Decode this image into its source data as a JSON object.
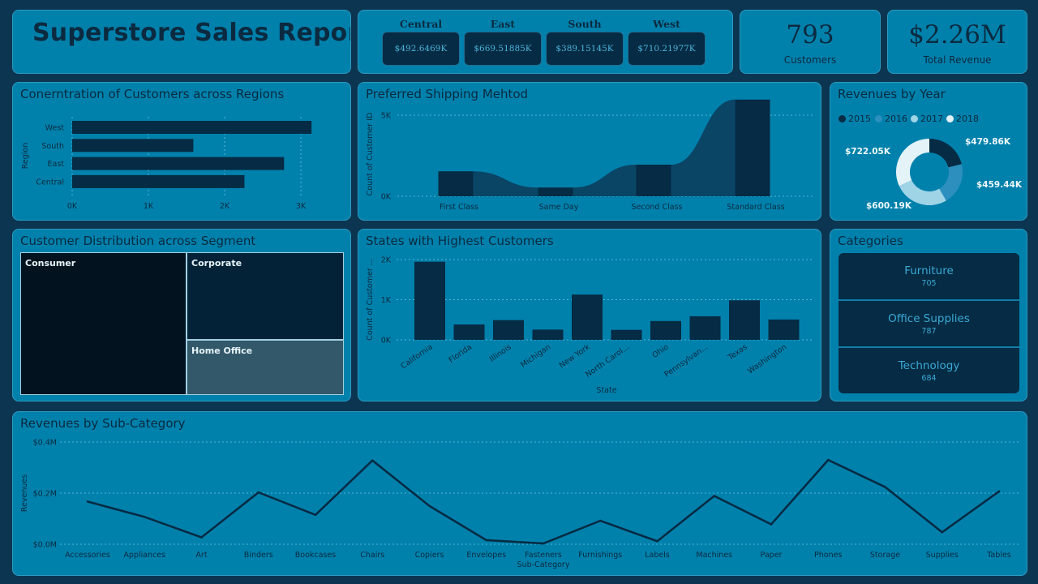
{
  "report_title": "Superstore Sales Report",
  "regions_kpi": [
    {
      "name": "Central",
      "value": "$492.6469K"
    },
    {
      "name": "East",
      "value": "$669.51885K"
    },
    {
      "name": "South",
      "value": "$389.15145K"
    },
    {
      "name": "West",
      "value": "$710.21977K"
    }
  ],
  "customers_kpi": {
    "value": "793",
    "label": "Customers"
  },
  "revenue_kpi": {
    "value": "$2.26M",
    "label": "Total Revenue"
  },
  "titles": {
    "regions": "Conerntration of Customers across Regions",
    "shipping": "Preferred Shipping Mehtod",
    "year": "Revenues by Year",
    "segment": "Customer Distribution across Segment",
    "states": "States with Highest Customers",
    "categories": "Categories",
    "subcat": "Revenues by Sub-Category"
  },
  "segments": [
    {
      "name": "Consumer",
      "color": "#02131f"
    },
    {
      "name": "Corporate",
      "color": "#042237"
    },
    {
      "name": "Home Office",
      "color": "#33586a"
    }
  ],
  "categories": [
    {
      "name": "Furniture",
      "count": "705"
    },
    {
      "name": "Office Supplies",
      "count": "787"
    },
    {
      "name": "Technology",
      "count": "684"
    }
  ],
  "colors": {
    "bar": "#062b44",
    "line": "#062b44",
    "area": "#0a4566"
  },
  "chart_data": [
    {
      "id": "regions",
      "type": "bar",
      "orientation": "horizontal",
      "categories": [
        "West",
        "South",
        "East",
        "Central"
      ],
      "values": [
        3140,
        1590,
        2780,
        2260
      ],
      "ylabel": "Region",
      "xticks": [
        0,
        1000,
        2000,
        3000
      ],
      "xtick_labels": [
        "0K",
        "1K",
        "2K",
        "3K"
      ],
      "xlim": [
        0,
        3200
      ],
      "grid": true
    },
    {
      "id": "shipping",
      "type": "bar",
      "categories": [
        "First Class",
        "Same Day",
        "Second Class",
        "Standard Class"
      ],
      "values": [
        1540,
        540,
        1950,
        5960
      ],
      "ylabel": "Count of Customer ID",
      "yticks": [
        0,
        5000
      ],
      "ytick_labels": [
        "0K",
        "5K"
      ],
      "ylim": [
        0,
        6000
      ],
      "grid": true
    },
    {
      "id": "year",
      "type": "pie",
      "donut": true,
      "labels": [
        "2015",
        "2016",
        "2017",
        "2018"
      ],
      "values": [
        479.86,
        459.44,
        600.19,
        722.05
      ],
      "value_labels": [
        "$479.86K",
        "$459.44K",
        "$600.19K",
        "$722.05K"
      ],
      "colors": [
        "#062b44",
        "#2c8fbd",
        "#9fd3e6",
        "#e3f3f8"
      ],
      "legend": "top-left"
    },
    {
      "id": "states",
      "type": "bar",
      "categories": [
        "California",
        "Florida",
        "Illinois",
        "Michigan",
        "New York",
        "North Carol...",
        "Ohio",
        "Pennsylvan...",
        "Texas",
        "Washington"
      ],
      "values": [
        1946,
        383,
        492,
        255,
        1128,
        249,
        469,
        587,
        985,
        506
      ],
      "xlabel": "State",
      "ylabel": "Count of Customer ...",
      "yticks": [
        0,
        1000,
        2000
      ],
      "ytick_labels": [
        "0K",
        "1K",
        "2K"
      ],
      "ylim": [
        0,
        2100
      ],
      "grid": true
    },
    {
      "id": "subcat",
      "type": "line",
      "categories": [
        "Accessories",
        "Appliances",
        "Art",
        "Binders",
        "Bookcases",
        "Chairs",
        "Copiers",
        "Envelopes",
        "Fasteners",
        "Furnishings",
        "Labels",
        "Machines",
        "Paper",
        "Phones",
        "Storage",
        "Supplies",
        "Tables"
      ],
      "values": [
        0.167,
        0.107,
        0.027,
        0.203,
        0.115,
        0.328,
        0.15,
        0.016,
        0.003,
        0.092,
        0.012,
        0.189,
        0.078,
        0.33,
        0.224,
        0.047,
        0.207
      ],
      "xlabel": "Sub-Category",
      "ylabel": "Revenues",
      "yticks": [
        0,
        0.2,
        0.4
      ],
      "ytick_labels": [
        "$0.0M",
        "$0.2M",
        "$0.4M"
      ],
      "ylim": [
        0,
        0.4
      ],
      "grid": true
    }
  ]
}
